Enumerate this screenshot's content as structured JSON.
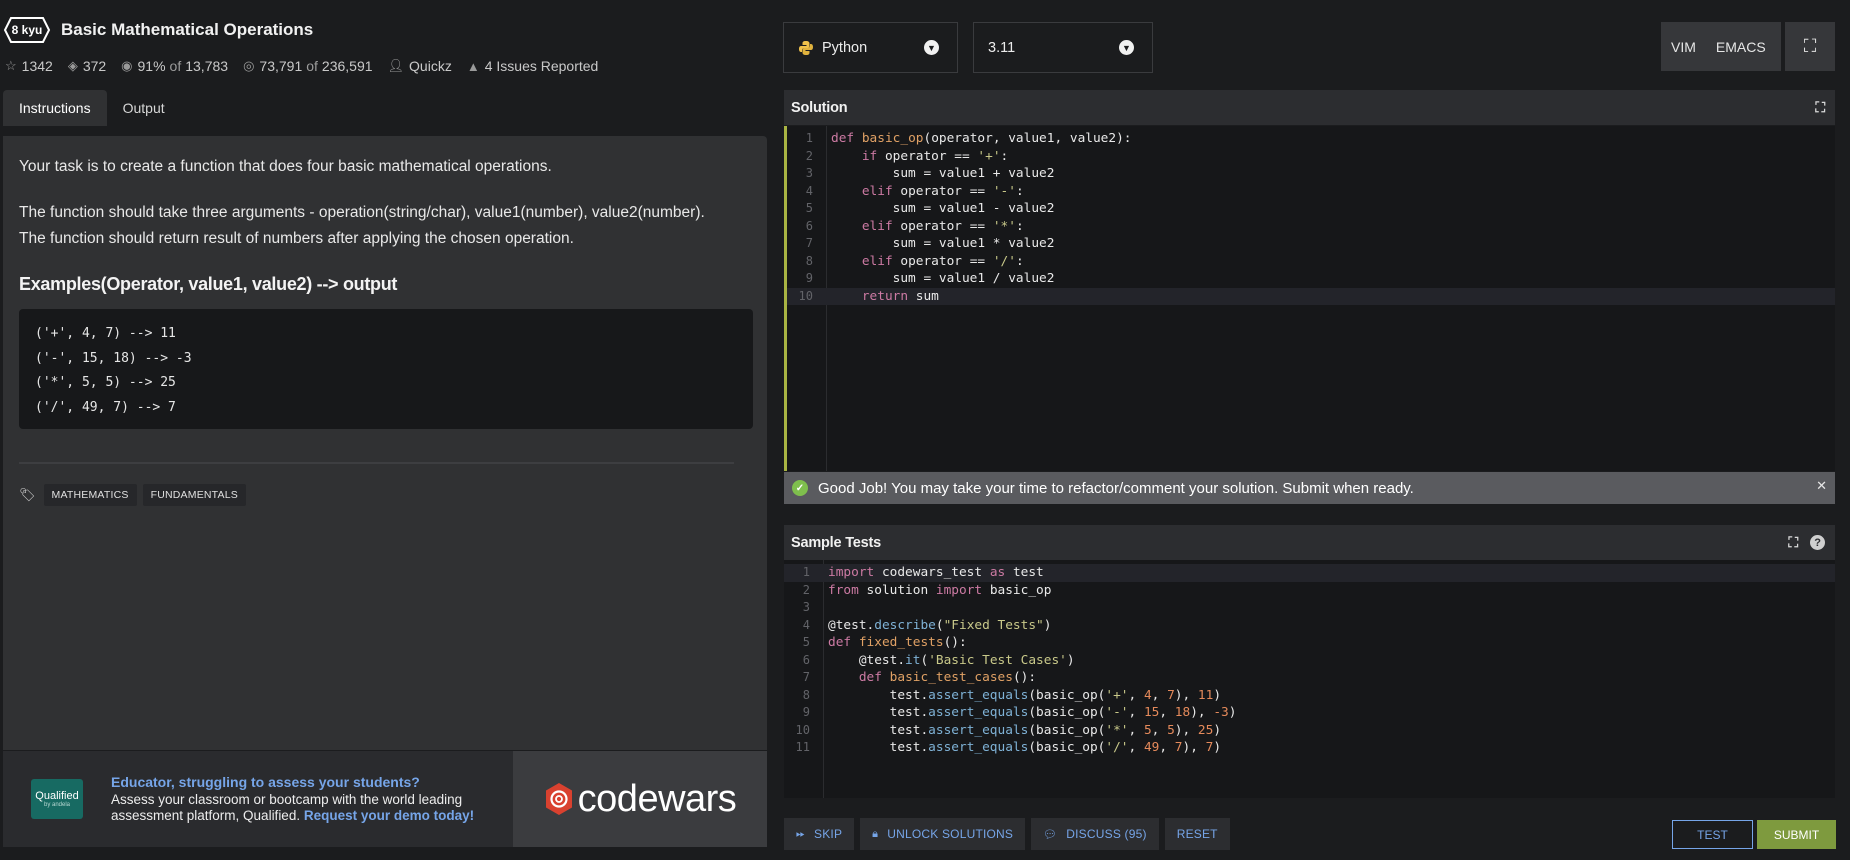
{
  "kata": {
    "rank": "8 kyu",
    "title": "Basic Mathematical Operations"
  },
  "stats": {
    "stars": "1342",
    "collections": "372",
    "satisfaction": "91%",
    "of_label": "of",
    "votes": "13,783",
    "completed": "73,791",
    "attempted": "236,591",
    "author": "Quickz",
    "issues": "4 Issues Reported"
  },
  "tabs": [
    "Instructions",
    "Output"
  ],
  "instructions": {
    "p1": "Your task is to create a function that does four basic mathematical operations.",
    "p2": "The function should take three arguments - operation(string/char), value1(number), value2(number).",
    "p3": "The function should return result of numbers after applying the chosen operation.",
    "heading": "Examples(Operator, value1, value2) --> output",
    "examples": [
      "('+', 4, 7) --> 11",
      "('-', 15, 18) --> -3",
      "('*', 5, 5) --> 25",
      "('/', 49, 7) --> 7"
    ],
    "tags": [
      "MATHEMATICS",
      "FUNDAMENTALS"
    ]
  },
  "ad": {
    "logo_text": "Qualified",
    "logo_sub": "by andela",
    "headline": "Educator, struggling to assess your students?",
    "body1": "Assess your classroom or bootcamp with the world leading",
    "body2": "assessment platform, Qualified.",
    "link": "Request your demo today!",
    "brand": "codewars"
  },
  "language": {
    "selected": "Python",
    "version": "3.11"
  },
  "editor_modes": [
    "VIM",
    "EMACS"
  ],
  "solution": {
    "title": "Solution",
    "line_numbers": [
      "1",
      "2",
      "3",
      "4",
      "5",
      "6",
      "7",
      "8",
      "9",
      "10"
    ]
  },
  "success_message": "Good Job! You may take your time to refactor/comment your solution. Submit when ready.",
  "sample_tests": {
    "title": "Sample Tests",
    "line_numbers": [
      "1",
      "2",
      "3",
      "4",
      "5",
      "6",
      "7",
      "8",
      "9",
      "10",
      "11"
    ]
  },
  "actions": {
    "skip": "SKIP",
    "unlock": "UNLOCK SOLUTIONS",
    "discuss": "DISCUSS (95)",
    "reset": "RESET",
    "test": "TEST",
    "submit": "SUBMIT"
  },
  "colors": {
    "accent_blue": "#76a5e8",
    "submit_green": "#7e9a3e",
    "success_check": "#7fbf4d",
    "editor_active_border": "#a9b443"
  }
}
